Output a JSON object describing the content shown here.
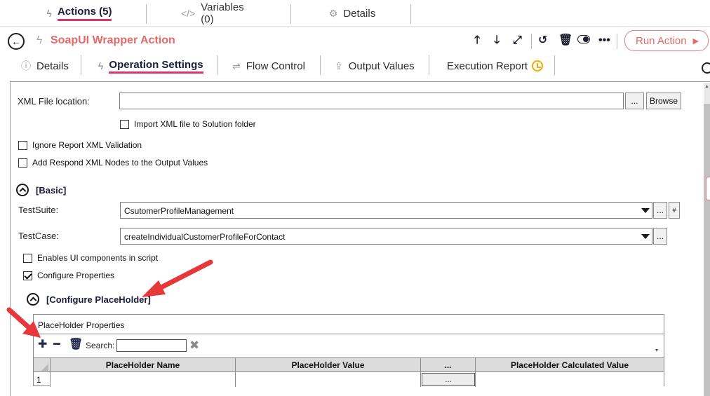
{
  "top_tabs": [
    {
      "label": "Actions (5)",
      "icon": "bolt-icon",
      "active": true
    },
    {
      "label": "Variables (0)",
      "icon": "code-icon",
      "active": false
    },
    {
      "label": "Details",
      "icon": "gear-icon",
      "active": false
    }
  ],
  "action": {
    "title": "SoapUI Wrapper Action",
    "run_label": "Run Action",
    "toolbar_icons": [
      "arrow-up-icon",
      "arrow-down-icon",
      "expand-icon",
      "undo-icon",
      "trash-icon",
      "toggle-icon",
      "more-icon"
    ]
  },
  "sub_tabs": [
    {
      "label": "Details",
      "icon": "info-icon",
      "active": false
    },
    {
      "label": "Operation Settings",
      "icon": "bolt-icon",
      "active": true
    },
    {
      "label": "Flow Control",
      "icon": "flow-icon",
      "active": false
    },
    {
      "label": "Output Values",
      "icon": "upload-icon",
      "active": false
    },
    {
      "label": "Execution Report",
      "icon": "clock-icon",
      "active": false
    }
  ],
  "form": {
    "xml_location_label": "XML File location:",
    "xml_location_value": "",
    "ellipsis": "...",
    "browse_label": "Browse",
    "import_xml_label": "Import XML file to Solution folder",
    "import_xml_checked": false,
    "ignore_report_label": "Ignore Report XML Validation",
    "ignore_report_checked": false,
    "add_respond_label": "Add Respond XML Nodes to the Output Values",
    "add_respond_checked": false,
    "basic_section": "[Basic]",
    "testsuite_label": "TestSuite:",
    "testsuite_value": "CsutomerProfileManagement",
    "testcase_label": "TestCase:",
    "testcase_value": "createIndividualCustomerProfileForContact",
    "hash_btn": "#",
    "enables_ui_label": "Enables UI components in script",
    "enables_ui_checked": false,
    "configure_props_label": "Configure Properties",
    "configure_props_checked": true,
    "placeholder_section": "[Configure PlaceHolder]"
  },
  "grid": {
    "title": "PlaceHolder Properties",
    "search_label": "Search:",
    "search_value": "",
    "columns": [
      "PlaceHolder Name",
      "PlaceHolder Value",
      "...",
      "PlaceHolder Calculated Value"
    ],
    "rows": [
      {
        "num": "1",
        "name": "",
        "value": "",
        "btn": "...",
        "calculated": ""
      }
    ]
  },
  "colors": {
    "accent": "#d8366a",
    "title_red": "#e46a6a",
    "annotation_red": "#e8373a"
  }
}
